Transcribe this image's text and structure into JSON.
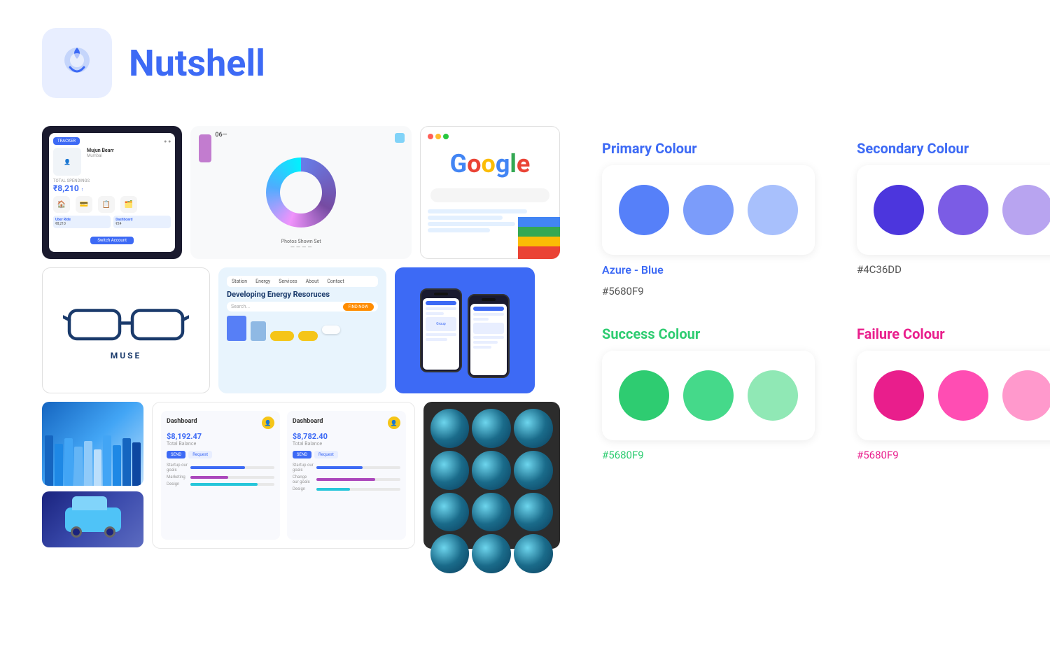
{
  "header": {
    "logo_emoji": "🌰",
    "app_name": "Nutshell"
  },
  "palette": {
    "primary": {
      "title": "Primary Colour",
      "name": "Azure - Blue",
      "hex": "#5680F9",
      "swatches": [
        "#5680F9",
        "#7B9CFA",
        "#A8C0FC"
      ]
    },
    "secondary": {
      "title": "Secondary Colour",
      "hex": "#4C36DD",
      "swatches": [
        "#4C36DD",
        "#7B5CE5",
        "#B8A4F0"
      ]
    },
    "success": {
      "title": "Success Colour",
      "hex": "#5680F9",
      "swatches": [
        "#2ECC71",
        "#45D98A",
        "#90E8B5"
      ]
    },
    "failure": {
      "title": "Failure Colour",
      "hex": "#5680F9",
      "swatches": [
        "#E91E8C",
        "#FF4DB3",
        "#FF99CC"
      ]
    }
  }
}
